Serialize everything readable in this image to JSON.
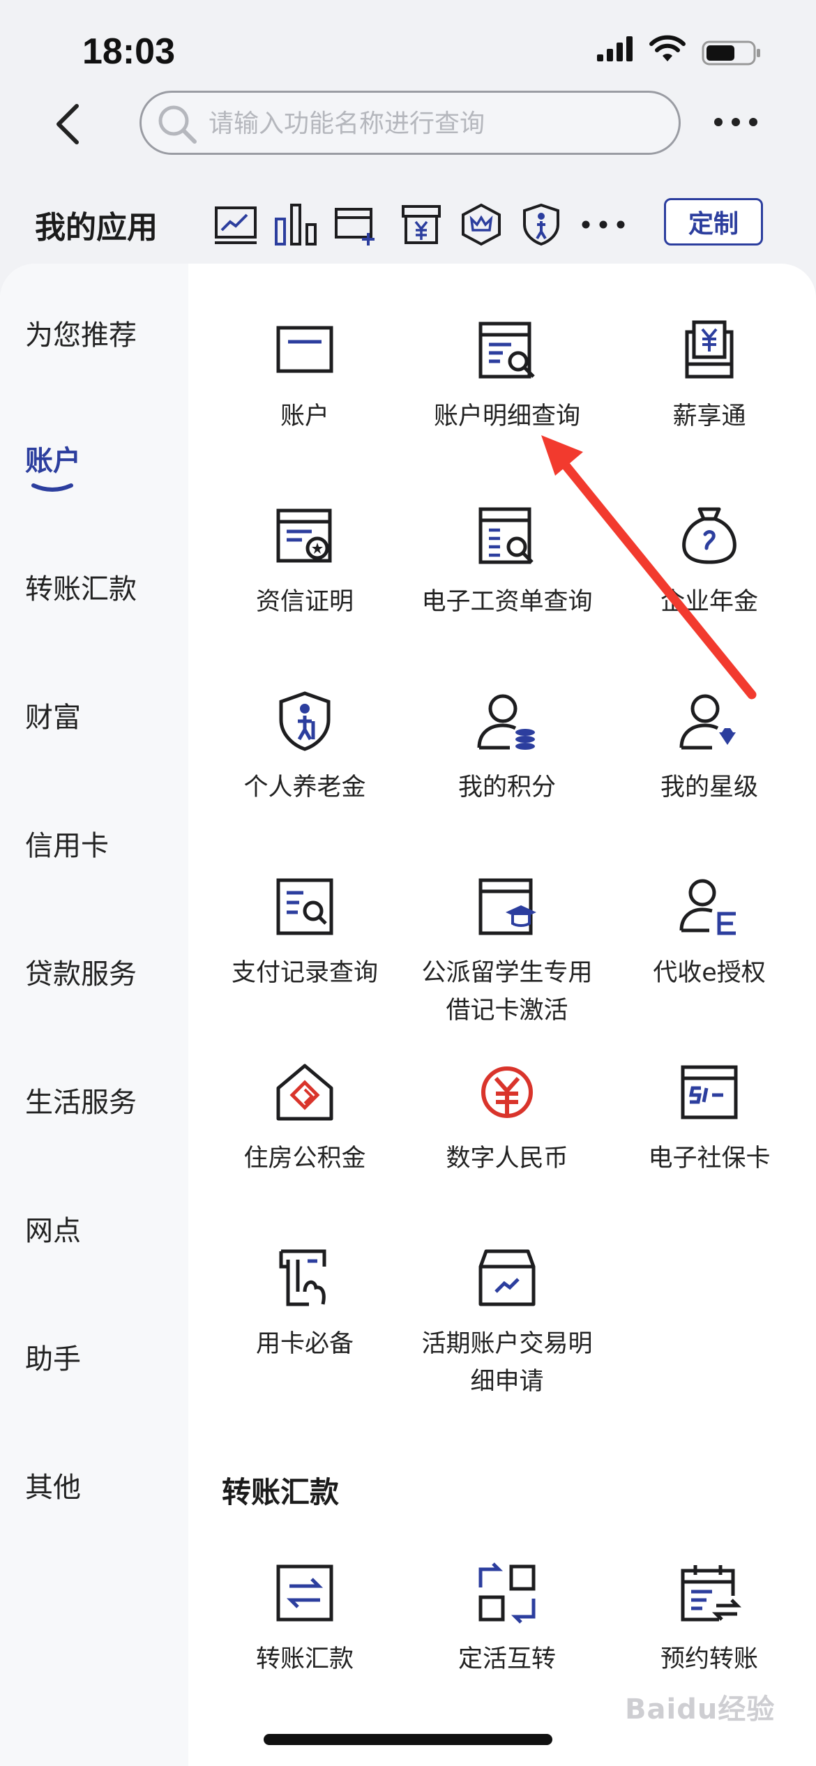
{
  "status_bar": {
    "time": "18:03"
  },
  "search": {
    "placeholder": "请输入功能名称进行查询",
    "value": ""
  },
  "my_apps": {
    "title": "我的应用",
    "customize_label": "定制"
  },
  "sidebar": {
    "items": [
      {
        "label": "为您推荐"
      },
      {
        "label": "账户",
        "active": true
      },
      {
        "label": "转账汇款"
      },
      {
        "label": "财富"
      },
      {
        "label": "信用卡"
      },
      {
        "label": "贷款服务"
      },
      {
        "label": "生活服务"
      },
      {
        "label": "网点"
      },
      {
        "label": "助手"
      },
      {
        "label": "其他"
      }
    ]
  },
  "account_section": {
    "items": [
      {
        "label": "账户",
        "icon": "card-icon"
      },
      {
        "label": "账户明细查询",
        "icon": "statement-search-icon"
      },
      {
        "label": "薪享通",
        "icon": "salary-icon"
      },
      {
        "label": "资信证明",
        "icon": "certificate-icon"
      },
      {
        "label": "电子工资单查询",
        "icon": "payslip-search-icon"
      },
      {
        "label": "企业年金",
        "icon": "money-bag-icon"
      },
      {
        "label": "个人养老金",
        "icon": "pension-shield-icon"
      },
      {
        "label": "我的积分",
        "icon": "user-points-icon"
      },
      {
        "label": "我的星级",
        "icon": "user-star-level-icon"
      },
      {
        "label": "支付记录查询",
        "icon": "payment-record-icon"
      },
      {
        "label": "公派留学生专用借记卡激活",
        "icon": "student-card-icon"
      },
      {
        "label": "代收e授权",
        "icon": "user-e-auth-icon"
      },
      {
        "label": "住房公积金",
        "icon": "housing-fund-icon"
      },
      {
        "label": "数字人民币",
        "icon": "digital-rmb-icon"
      },
      {
        "label": "电子社保卡",
        "icon": "social-security-card-icon"
      },
      {
        "label": "用卡必备",
        "icon": "card-essentials-icon"
      },
      {
        "label": "活期账户交易明细申请",
        "icon": "account-detail-request-icon"
      }
    ]
  },
  "transfer_section": {
    "title": "转账汇款",
    "items": [
      {
        "label": "转账汇款",
        "icon": "transfer-icon"
      },
      {
        "label": "定活互转",
        "icon": "fixed-current-switch-icon"
      },
      {
        "label": "预约转账",
        "icon": "scheduled-transfer-icon"
      }
    ]
  },
  "watermark": {
    "text": "Baidu经验"
  },
  "colors": {
    "accent_blue": "#2c3e9e",
    "icon_dark": "#1d1d1f",
    "annotation_red": "#f23a2e",
    "digital_rmb_red": "#d9342b"
  }
}
